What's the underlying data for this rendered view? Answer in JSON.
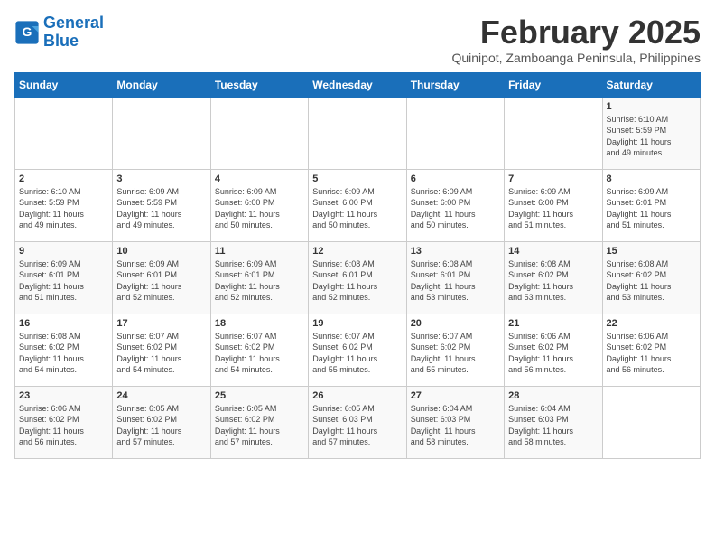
{
  "logo": {
    "line1": "General",
    "line2": "Blue"
  },
  "title": "February 2025",
  "subtitle": "Quinipot, Zamboanga Peninsula, Philippines",
  "days_of_week": [
    "Sunday",
    "Monday",
    "Tuesday",
    "Wednesday",
    "Thursday",
    "Friday",
    "Saturday"
  ],
  "weeks": [
    [
      {
        "day": "",
        "info": ""
      },
      {
        "day": "",
        "info": ""
      },
      {
        "day": "",
        "info": ""
      },
      {
        "day": "",
        "info": ""
      },
      {
        "day": "",
        "info": ""
      },
      {
        "day": "",
        "info": ""
      },
      {
        "day": "1",
        "info": "Sunrise: 6:10 AM\nSunset: 5:59 PM\nDaylight: 11 hours\nand 49 minutes."
      }
    ],
    [
      {
        "day": "2",
        "info": "Sunrise: 6:10 AM\nSunset: 5:59 PM\nDaylight: 11 hours\nand 49 minutes."
      },
      {
        "day": "3",
        "info": "Sunrise: 6:09 AM\nSunset: 5:59 PM\nDaylight: 11 hours\nand 49 minutes."
      },
      {
        "day": "4",
        "info": "Sunrise: 6:09 AM\nSunset: 6:00 PM\nDaylight: 11 hours\nand 50 minutes."
      },
      {
        "day": "5",
        "info": "Sunrise: 6:09 AM\nSunset: 6:00 PM\nDaylight: 11 hours\nand 50 minutes."
      },
      {
        "day": "6",
        "info": "Sunrise: 6:09 AM\nSunset: 6:00 PM\nDaylight: 11 hours\nand 50 minutes."
      },
      {
        "day": "7",
        "info": "Sunrise: 6:09 AM\nSunset: 6:00 PM\nDaylight: 11 hours\nand 51 minutes."
      },
      {
        "day": "8",
        "info": "Sunrise: 6:09 AM\nSunset: 6:01 PM\nDaylight: 11 hours\nand 51 minutes."
      }
    ],
    [
      {
        "day": "9",
        "info": "Sunrise: 6:09 AM\nSunset: 6:01 PM\nDaylight: 11 hours\nand 51 minutes."
      },
      {
        "day": "10",
        "info": "Sunrise: 6:09 AM\nSunset: 6:01 PM\nDaylight: 11 hours\nand 52 minutes."
      },
      {
        "day": "11",
        "info": "Sunrise: 6:09 AM\nSunset: 6:01 PM\nDaylight: 11 hours\nand 52 minutes."
      },
      {
        "day": "12",
        "info": "Sunrise: 6:08 AM\nSunset: 6:01 PM\nDaylight: 11 hours\nand 52 minutes."
      },
      {
        "day": "13",
        "info": "Sunrise: 6:08 AM\nSunset: 6:01 PM\nDaylight: 11 hours\nand 53 minutes."
      },
      {
        "day": "14",
        "info": "Sunrise: 6:08 AM\nSunset: 6:02 PM\nDaylight: 11 hours\nand 53 minutes."
      },
      {
        "day": "15",
        "info": "Sunrise: 6:08 AM\nSunset: 6:02 PM\nDaylight: 11 hours\nand 53 minutes."
      }
    ],
    [
      {
        "day": "16",
        "info": "Sunrise: 6:08 AM\nSunset: 6:02 PM\nDaylight: 11 hours\nand 54 minutes."
      },
      {
        "day": "17",
        "info": "Sunrise: 6:07 AM\nSunset: 6:02 PM\nDaylight: 11 hours\nand 54 minutes."
      },
      {
        "day": "18",
        "info": "Sunrise: 6:07 AM\nSunset: 6:02 PM\nDaylight: 11 hours\nand 54 minutes."
      },
      {
        "day": "19",
        "info": "Sunrise: 6:07 AM\nSunset: 6:02 PM\nDaylight: 11 hours\nand 55 minutes."
      },
      {
        "day": "20",
        "info": "Sunrise: 6:07 AM\nSunset: 6:02 PM\nDaylight: 11 hours\nand 55 minutes."
      },
      {
        "day": "21",
        "info": "Sunrise: 6:06 AM\nSunset: 6:02 PM\nDaylight: 11 hours\nand 56 minutes."
      },
      {
        "day": "22",
        "info": "Sunrise: 6:06 AM\nSunset: 6:02 PM\nDaylight: 11 hours\nand 56 minutes."
      }
    ],
    [
      {
        "day": "23",
        "info": "Sunrise: 6:06 AM\nSunset: 6:02 PM\nDaylight: 11 hours\nand 56 minutes."
      },
      {
        "day": "24",
        "info": "Sunrise: 6:05 AM\nSunset: 6:02 PM\nDaylight: 11 hours\nand 57 minutes."
      },
      {
        "day": "25",
        "info": "Sunrise: 6:05 AM\nSunset: 6:02 PM\nDaylight: 11 hours\nand 57 minutes."
      },
      {
        "day": "26",
        "info": "Sunrise: 6:05 AM\nSunset: 6:03 PM\nDaylight: 11 hours\nand 57 minutes."
      },
      {
        "day": "27",
        "info": "Sunrise: 6:04 AM\nSunset: 6:03 PM\nDaylight: 11 hours\nand 58 minutes."
      },
      {
        "day": "28",
        "info": "Sunrise: 6:04 AM\nSunset: 6:03 PM\nDaylight: 11 hours\nand 58 minutes."
      },
      {
        "day": "",
        "info": ""
      }
    ]
  ]
}
